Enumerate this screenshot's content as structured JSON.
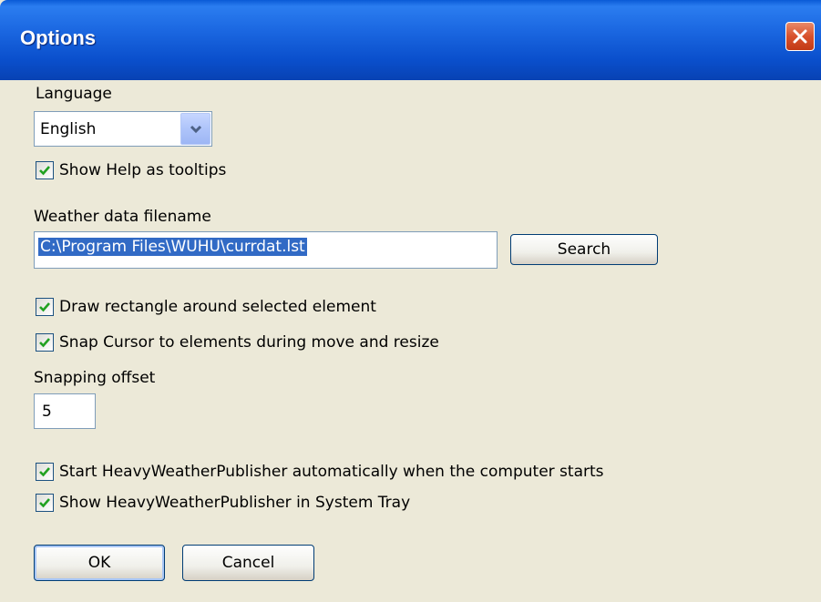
{
  "window": {
    "title": "Options"
  },
  "language": {
    "label": "Language",
    "selected": "English"
  },
  "checkboxes": {
    "show_help": {
      "label": "Show Help as tooltips",
      "checked": true
    },
    "draw_rect": {
      "label": "Draw rectangle around selected element",
      "checked": true
    },
    "snap_cursor": {
      "label": "Snap Cursor to elements during move and resize",
      "checked": true
    },
    "autostart": {
      "label": "Start HeavyWeatherPublisher automatically when the computer starts",
      "checked": true
    },
    "system_tray": {
      "label": "Show HeavyWeatherPublisher in System Tray",
      "checked": true
    }
  },
  "weather_file": {
    "label": "Weather data filename",
    "value": "C:\\Program Files\\WUHU\\currdat.lst",
    "search_label": "Search"
  },
  "snapping": {
    "label": "Snapping offset",
    "value": "5"
  },
  "buttons": {
    "ok": "OK",
    "cancel": "Cancel"
  },
  "colors": {
    "titlebar": "#0a4fcc",
    "dialog_bg": "#ece9d8",
    "selection": "#316ac5",
    "check": "#21a121"
  }
}
